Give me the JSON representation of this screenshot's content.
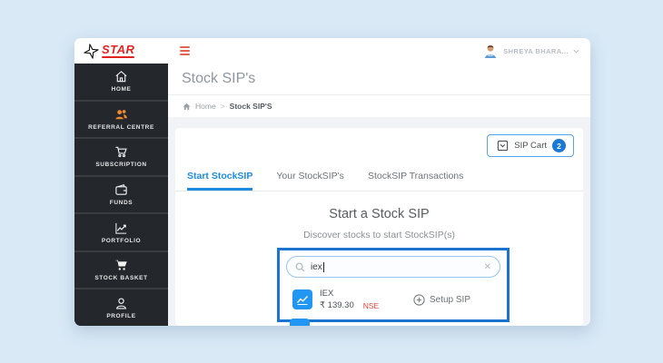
{
  "topbar": {
    "brand": "STAR",
    "user": {
      "name": "SHREYA BHARA..."
    }
  },
  "sidebar": {
    "items": [
      {
        "label": "HOME",
        "icon": "home-icon"
      },
      {
        "label": "REFERRAL CENTRE",
        "icon": "referral-people-icon"
      },
      {
        "label": "SUBSCRIPTION",
        "icon": "cart-outline-icon"
      },
      {
        "label": "FUNDS",
        "icon": "wallet-icon"
      },
      {
        "label": "PORTFOLIO",
        "icon": "chart-line-icon"
      },
      {
        "label": "STOCK BASKET",
        "icon": "basket-cart-icon"
      },
      {
        "label": "PROFILE",
        "icon": "person-icon"
      }
    ]
  },
  "page": {
    "title": "Stock SIP's",
    "breadcrumb": {
      "home": "Home",
      "separator": ">",
      "current": "Stock SIP'S"
    }
  },
  "content": {
    "sip_cart": {
      "label": "SIP Cart",
      "count": "2"
    },
    "tabs": [
      {
        "label": "Start StockSIP"
      },
      {
        "label": "Your StockSIP's"
      },
      {
        "label": "StockSIP Transactions"
      }
    ],
    "heading": "Start a Stock SIP",
    "subheading": "Discover stocks to start StockSIP(s)",
    "search": {
      "value": "iex",
      "clear": "✕"
    },
    "result": {
      "symbol": "IEX",
      "price": "₹ 139.30",
      "exchange": "NSE",
      "action": "Setup SIP"
    }
  },
  "colors": {
    "accent_blue": "#1d8ce0",
    "annotation_blue": "#1b75d0",
    "brand_red": "#e02421",
    "sidebar_orange": "#f0882d",
    "nse_red": "#ee4438",
    "badge_blue": "#1a78d6"
  }
}
